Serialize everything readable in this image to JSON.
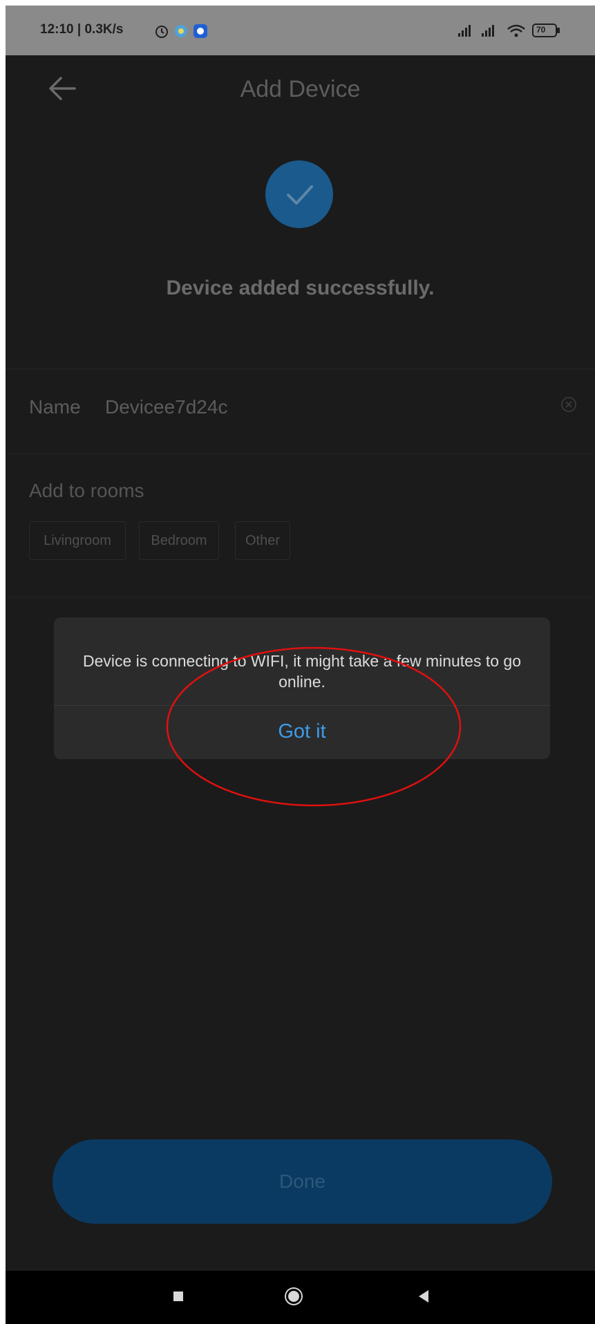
{
  "status_bar": {
    "time_speed": "12:10 | 0.3K/s",
    "battery": "70"
  },
  "header": {
    "title": "Add Device"
  },
  "success": {
    "message": "Device added successfully."
  },
  "name_row": {
    "label": "Name",
    "value": "Devicee7d24c"
  },
  "rooms": {
    "label": "Add to rooms",
    "options": [
      "Livingroom",
      "Bedroom",
      "Other"
    ]
  },
  "dialog": {
    "message": "Device is connecting to WIFI, it might take a few minutes to go online.",
    "button": "Got it"
  },
  "done_button": "Done",
  "colors": {
    "accent": "#3d9be9",
    "annotation": "#e01010"
  }
}
